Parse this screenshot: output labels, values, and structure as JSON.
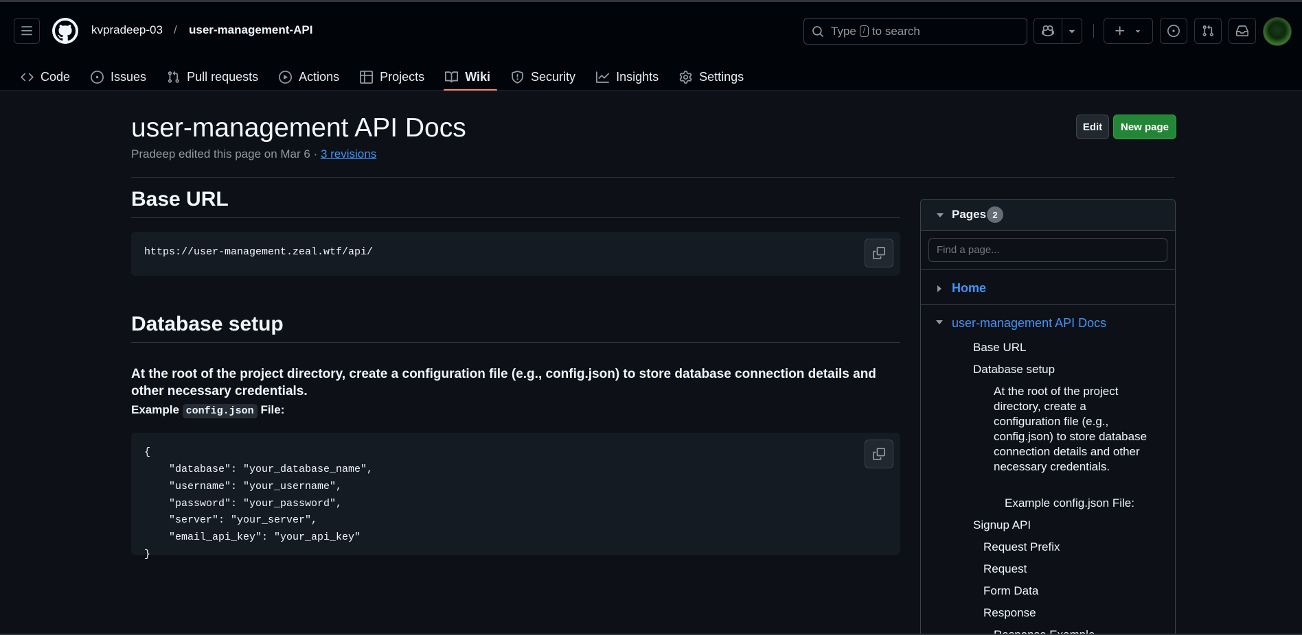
{
  "header": {
    "owner": "kvpradeep-03",
    "separator": "/",
    "repo": "user-management-API",
    "search": {
      "before": "Type",
      "key": "/",
      "after": "to search"
    }
  },
  "nav": [
    {
      "label": "Code",
      "icon": "code-icon"
    },
    {
      "label": "Issues",
      "icon": "issue-icon"
    },
    {
      "label": "Pull requests",
      "icon": "pull-request-icon"
    },
    {
      "label": "Actions",
      "icon": "play-icon"
    },
    {
      "label": "Projects",
      "icon": "table-icon"
    },
    {
      "label": "Wiki",
      "icon": "book-icon",
      "active": true
    },
    {
      "label": "Security",
      "icon": "shield-icon"
    },
    {
      "label": "Insights",
      "icon": "graph-icon"
    },
    {
      "label": "Settings",
      "icon": "gear-icon"
    }
  ],
  "page": {
    "title": "user-management API Docs",
    "subtitle_text": "Pradeep edited this page on Mar 6 · ",
    "revisions": "3 revisions",
    "edit_label": "Edit",
    "new_page_label": "New page"
  },
  "content": {
    "base_url_heading": "Base URL",
    "base_url": "https://user-management.zeal.wtf/api/",
    "db_heading": "Database setup",
    "db_paragraph": "At the root of the project directory, create a configuration file (e.g., config.json) to store database connection details and other necessary credentials.",
    "example_prefix": "Example",
    "example_code": "config.json",
    "example_suffix": "File:",
    "config_lines": [
      "{",
      "    \"database\": \"your_database_name\",",
      "    \"username\": \"your_username\",",
      "    \"password\": \"your_password\",",
      "    \"server\": \"your_server\",",
      "    \"email_api_key\": \"your_api_key\"",
      "}"
    ]
  },
  "sidebar": {
    "title": "Pages",
    "count": "2",
    "find_placeholder": "Find a page...",
    "home": "Home",
    "current": "user-management API Docs",
    "toc": {
      "base_url": "Base URL",
      "database_setup": "Database setup",
      "db_desc": "At the root of the project directory, create a configuration file (e.g., config.json) to store database connection details and other necessary credentials.",
      "example": "Example config.json File:",
      "signup_api": "Signup API",
      "request_prefix": "Request Prefix",
      "request": "Request",
      "form_data": "Form Data",
      "response": "Response",
      "response_example": "Response Example"
    }
  }
}
